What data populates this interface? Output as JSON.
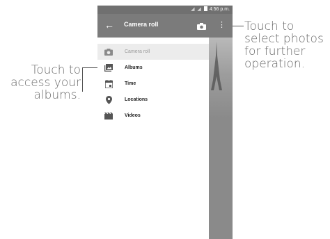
{
  "callouts": {
    "left": [
      "Touch to",
      "access your",
      "albums."
    ],
    "right": [
      "Touch to",
      "select photos",
      "for further",
      "operation."
    ]
  },
  "status_bar": {
    "time": "4:56 p.m."
  },
  "app_bar": {
    "title": "Camera roll",
    "back_icon": "arrow-back-icon",
    "camera_icon": "camera-icon",
    "more_icon": "more-vert-icon"
  },
  "drawer": {
    "items": [
      {
        "label": "Camera roll",
        "icon": "camera-icon",
        "selected": true
      },
      {
        "label": "Albums",
        "icon": "photo-album-icon",
        "selected": false
      },
      {
        "label": "Time",
        "icon": "calendar-icon",
        "selected": false
      },
      {
        "label": "Locations",
        "icon": "location-pin-icon",
        "selected": false
      },
      {
        "label": "Videos",
        "icon": "film-icon",
        "selected": false
      }
    ]
  },
  "colors": {
    "app_bar": "#7b7b7b",
    "status_bar": "#707070",
    "drawer_selected": "#ececec"
  }
}
